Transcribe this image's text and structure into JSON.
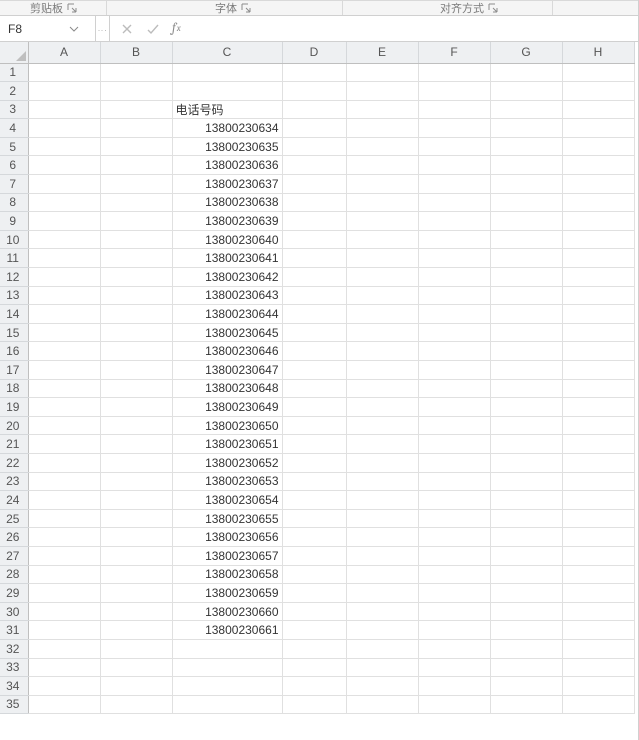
{
  "ribbon": {
    "group1_label": "剪贴板",
    "group2_label": "字体",
    "group3_label": "对齐方式"
  },
  "namebox": {
    "value": "F8"
  },
  "formula": {
    "value": ""
  },
  "columns": [
    "A",
    "B",
    "C",
    "D",
    "E",
    "F",
    "G",
    "H"
  ],
  "row_count": 35,
  "cells": {
    "C3": {
      "v": "电话号码",
      "type": "txt"
    },
    "C4": {
      "v": "13800230634",
      "type": "num"
    },
    "C5": {
      "v": "13800230635",
      "type": "num"
    },
    "C6": {
      "v": "13800230636",
      "type": "num"
    },
    "C7": {
      "v": "13800230637",
      "type": "num"
    },
    "C8": {
      "v": "13800230638",
      "type": "num"
    },
    "C9": {
      "v": "13800230639",
      "type": "num"
    },
    "C10": {
      "v": "13800230640",
      "type": "num"
    },
    "C11": {
      "v": "13800230641",
      "type": "num"
    },
    "C12": {
      "v": "13800230642",
      "type": "num"
    },
    "C13": {
      "v": "13800230643",
      "type": "num"
    },
    "C14": {
      "v": "13800230644",
      "type": "num"
    },
    "C15": {
      "v": "13800230645",
      "type": "num"
    },
    "C16": {
      "v": "13800230646",
      "type": "num"
    },
    "C17": {
      "v": "13800230647",
      "type": "num"
    },
    "C18": {
      "v": "13800230648",
      "type": "num"
    },
    "C19": {
      "v": "13800230649",
      "type": "num"
    },
    "C20": {
      "v": "13800230650",
      "type": "num"
    },
    "C21": {
      "v": "13800230651",
      "type": "num"
    },
    "C22": {
      "v": "13800230652",
      "type": "num"
    },
    "C23": {
      "v": "13800230653",
      "type": "num"
    },
    "C24": {
      "v": "13800230654",
      "type": "num"
    },
    "C25": {
      "v": "13800230655",
      "type": "num"
    },
    "C26": {
      "v": "13800230656",
      "type": "num"
    },
    "C27": {
      "v": "13800230657",
      "type": "num"
    },
    "C28": {
      "v": "13800230658",
      "type": "num"
    },
    "C29": {
      "v": "13800230659",
      "type": "num"
    },
    "C30": {
      "v": "13800230660",
      "type": "num"
    },
    "C31": {
      "v": "13800230661",
      "type": "num"
    }
  }
}
